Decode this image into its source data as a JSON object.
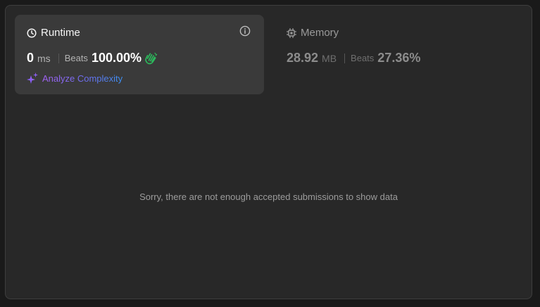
{
  "runtime": {
    "title": "Runtime",
    "value": "0",
    "unit": "ms",
    "beats_label": "Beats",
    "beats_value": "100.00%",
    "analyze_label": "Analyze Complexity"
  },
  "memory": {
    "title": "Memory",
    "value": "28.92",
    "unit": "MB",
    "beats_label": "Beats",
    "beats_value": "27.36%"
  },
  "empty_message": "Sorry, there are not enough accepted submissions to show data",
  "icons": {
    "runtime": "clock-icon",
    "info": "info-icon",
    "beats": "clapping-hands-icon",
    "analyze": "sparkle-icon",
    "memory": "chip-icon"
  },
  "colors": {
    "clap": "#2cbb5d",
    "analyze_start": "#a361f2",
    "analyze_end": "#3c8ff0"
  }
}
